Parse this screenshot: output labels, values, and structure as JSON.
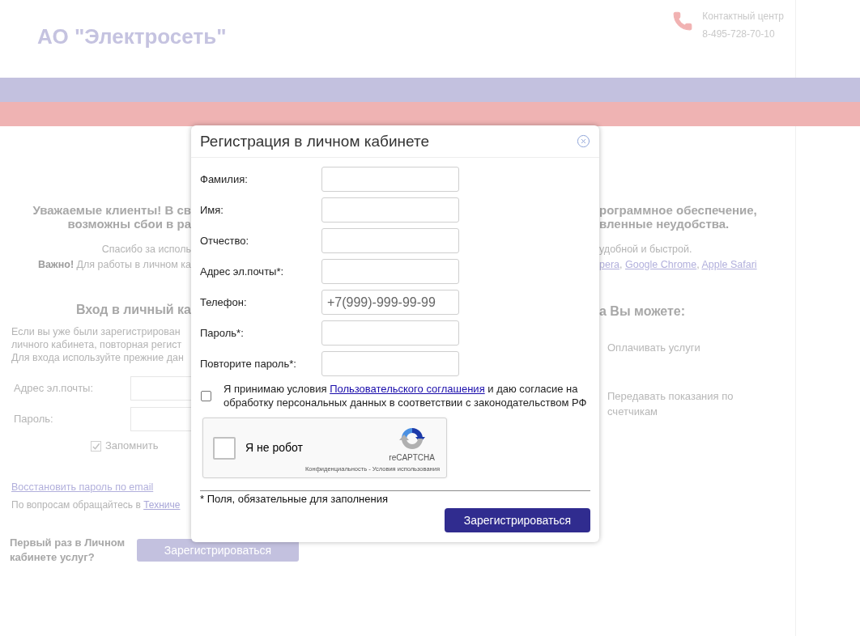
{
  "header": {
    "title": "АО \"Электросеть\"",
    "contact": {
      "label": "Контактный центр",
      "phone": "8-495-728-70-10"
    }
  },
  "notice": {
    "heading_left": [
      "Уважаемые клиенты! В св",
      "возможны сбои в ра"
    ],
    "heading_right": [
      "рограммное обеспечение,",
      "вленные неудобства."
    ],
    "text_left": [
      "Спасибо за исполь",
      "**Важно!** Для работы в личном ка"
    ],
    "text_right": "удобной и быстрой.",
    "browser_links": [
      "pera",
      "Google Chrome",
      "Apple Safari"
    ],
    "link_separator": ","
  },
  "login": {
    "heading": "Вход в личный ка",
    "intro": [
      "Если вы уже были зарегистрирован",
      "личного кабинета, повторная регист",
      "Для входа используйте прежние дан"
    ],
    "fields": [
      {
        "label": "Адрес эл.почты:"
      },
      {
        "label": "Пароль:"
      }
    ],
    "remember": {
      "label": "Запомнить",
      "checked": true
    },
    "restore_link": "Восстановить пароль по email",
    "support": {
      "text": "По вопросам обращайтесь в",
      "link": "Техниче"
    },
    "first_time": "Первый раз в Личном кабинете услуг?",
    "register_button": "Зарегистрироваться"
  },
  "features": {
    "heading": "а Вы можете:",
    "items": [
      "Оплачивать услуги",
      "Передавать показания по счетчикам"
    ]
  },
  "dialog": {
    "title": "Регистрация в личном кабинете",
    "fields": [
      {
        "label": "Фамилия:"
      },
      {
        "label": "Имя:"
      },
      {
        "label": "Отчество:"
      },
      {
        "label": "Адрес эл.почты*:"
      },
      {
        "label": "Телефон:",
        "placeholder": "+7(999)-999-99-99"
      },
      {
        "label": "Пароль*:"
      },
      {
        "label": "Повторите пароль*:"
      }
    ],
    "consent": {
      "checked": false,
      "before": "Я принимаю условия",
      "link": "Пользовательского соглашения",
      "after": "и даю согласие на обработку персональных данных в соответствии с законодательством РФ"
    },
    "captcha": {
      "checked": false,
      "label": "Я не робот",
      "brand": "reCAPTCHA",
      "links": [
        "Конфиденциальность",
        "Условия использования"
      ],
      "separator": "-"
    },
    "required_note": "* Поля, обязательные для заполнения",
    "submit": "Зарегистрироваться"
  }
}
